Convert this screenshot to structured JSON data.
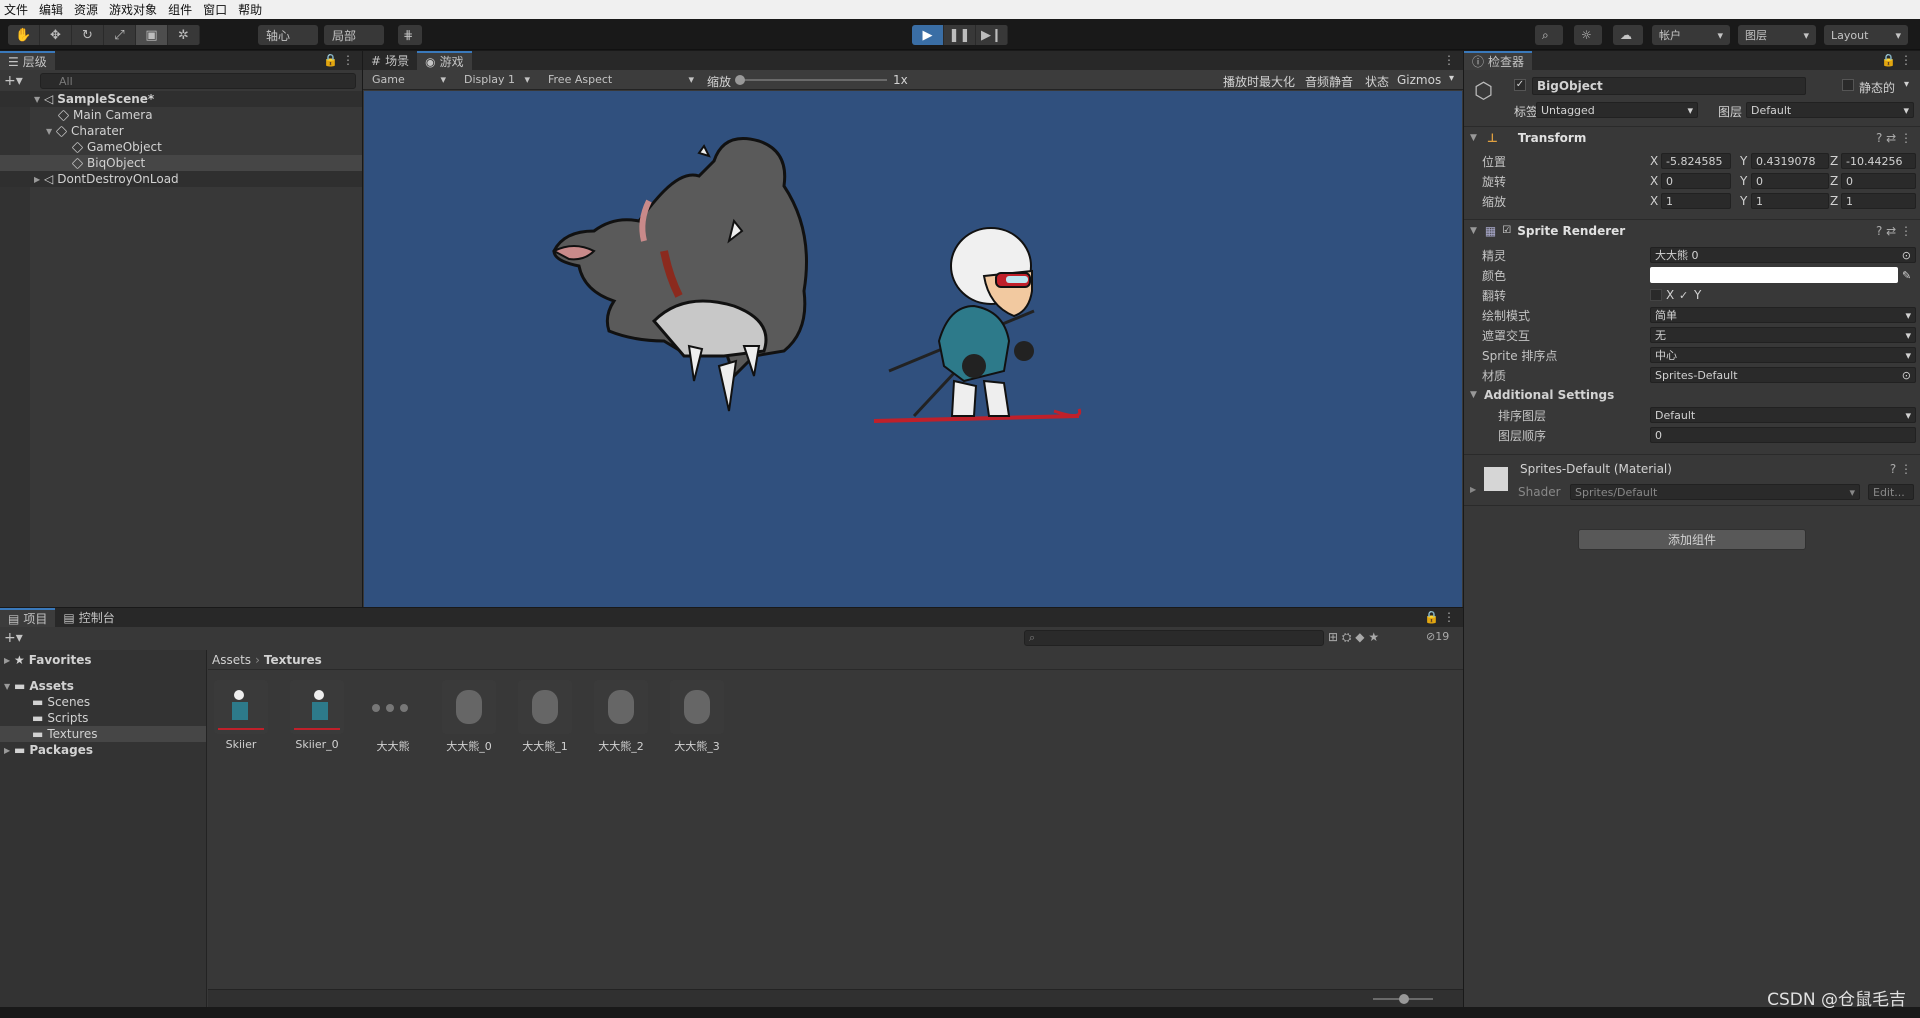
{
  "menu": [
    "文件",
    "编辑",
    "资源",
    "游戏对象",
    "组件",
    "窗口",
    "帮助"
  ],
  "toolbar": {
    "pivot": "轴心",
    "local": "局部",
    "account": "帐户",
    "layers": "图层",
    "layout": "Layout"
  },
  "hierarchy": {
    "tab": "层级",
    "search_placeholder": "All",
    "items": [
      {
        "label": "SampleScene*",
        "depth": 0
      },
      {
        "label": "Main Camera",
        "depth": 1
      },
      {
        "label": "Charater",
        "depth": 1
      },
      {
        "label": "GameObject",
        "depth": 2
      },
      {
        "label": "BiqObject",
        "depth": 2
      },
      {
        "label": "DontDestroyOnLoad",
        "depth": 0
      }
    ]
  },
  "game": {
    "tab_scene": "场景",
    "tab_game": "游戏",
    "mode": "Game",
    "display": "Display 1",
    "aspect": "Free Aspect",
    "scale_label": "缩放",
    "scale_value": "1x",
    "maximize": "播放时最大化",
    "mute": "音频静音",
    "stats": "状态",
    "gizmos": "Gizmos",
    "bg_color": "#30507e"
  },
  "inspector": {
    "tab": "检查器",
    "object_name": "BigObject",
    "static_label": "静态的",
    "tag_label": "标签",
    "tag_value": "Untagged",
    "layer_label": "图层",
    "layer_value": "Default",
    "transform": {
      "title": "Transform",
      "position_label": "位置",
      "pos_x": "-5.824585",
      "pos_y": "0.4319078",
      "pos_z": "-10.44256",
      "rotation_label": "旋转",
      "rot_x": "0",
      "rot_y": "0",
      "rot_z": "0",
      "scale_label": "缩放",
      "scale_x": "1",
      "scale_y": "1",
      "scale_z": "1"
    },
    "sprite_renderer": {
      "title": "Sprite Renderer",
      "sprite_label": "精灵",
      "sprite_value": "大大熊 0",
      "color_label": "颜色",
      "flip_label": "翻转",
      "flip_x": "X",
      "flip_y": "Y",
      "draw_mode_label": "绘制模式",
      "draw_mode_value": "简单",
      "mask_label": "遮罩交互",
      "mask_value": "无",
      "sort_point_label": "Sprite 排序点",
      "sort_point_value": "中心",
      "material_label": "材质",
      "material_value": "Sprites-Default",
      "additional": "Additional Settings",
      "sorting_layer_label": "排序图层",
      "sorting_layer_value": "Default",
      "order_label": "图层顺序",
      "order_value": "0"
    },
    "material": {
      "title": "Sprites-Default (Material)",
      "shader_label": "Shader",
      "shader_value": "Sprites/Default",
      "edit": "Edit..."
    },
    "add_component": "添加组件"
  },
  "project": {
    "tab_project": "项目",
    "tab_console": "控制台",
    "hidden_count": "19",
    "tree": {
      "favorites": "Favorites",
      "assets": "Assets",
      "scenes": "Scenes",
      "scripts": "Scripts",
      "textures": "Textures",
      "packages": "Packages"
    },
    "breadcrumb": [
      "Assets",
      "Textures"
    ],
    "assets": [
      "Skiier",
      "Skiier_0",
      "大大熊",
      "大大熊_0",
      "大大熊_1",
      "大大熊_2",
      "大大熊_3"
    ]
  },
  "watermark": "CSDN @仓鼠毛吉"
}
